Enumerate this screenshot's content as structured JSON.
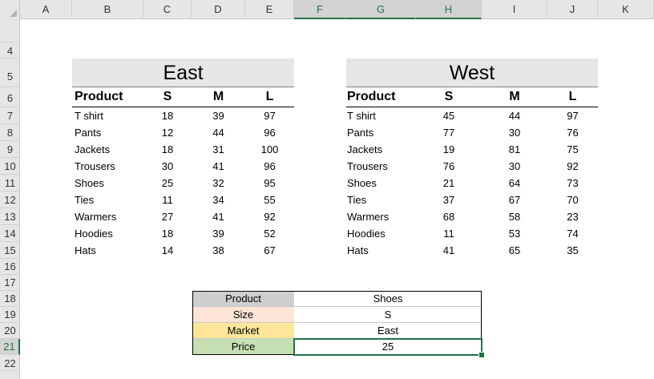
{
  "columns": [
    "A",
    "B",
    "C",
    "D",
    "E",
    "F",
    "G",
    "H",
    "I",
    "J",
    "K"
  ],
  "rows": [
    "4",
    "5",
    "6",
    "7",
    "8",
    "9",
    "10",
    "11",
    "12",
    "13",
    "14",
    "15",
    "16",
    "17",
    "18",
    "19",
    "20",
    "21",
    "22"
  ],
  "east": {
    "title": "East",
    "headers": [
      "Product",
      "S",
      "M",
      "L"
    ],
    "rows": [
      [
        "T shirt",
        "18",
        "39",
        "97"
      ],
      [
        "Pants",
        "12",
        "44",
        "96"
      ],
      [
        "Jackets",
        "18",
        "31",
        "100"
      ],
      [
        "Trousers",
        "30",
        "41",
        "96"
      ],
      [
        "Shoes",
        "25",
        "32",
        "95"
      ],
      [
        "Ties",
        "11",
        "34",
        "55"
      ],
      [
        "Warmers",
        "27",
        "41",
        "92"
      ],
      [
        "Hoodies",
        "18",
        "39",
        "52"
      ],
      [
        "Hats",
        "14",
        "38",
        "67"
      ]
    ]
  },
  "west": {
    "title": "West",
    "headers": [
      "Product",
      "S",
      "M",
      "L"
    ],
    "rows": [
      [
        "T shirt",
        "45",
        "44",
        "97"
      ],
      [
        "Pants",
        "77",
        "30",
        "76"
      ],
      [
        "Jackets",
        "19",
        "81",
        "75"
      ],
      [
        "Trousers",
        "76",
        "30",
        "92"
      ],
      [
        "Shoes",
        "21",
        "64",
        "73"
      ],
      [
        "Ties",
        "37",
        "67",
        "70"
      ],
      [
        "Warmers",
        "68",
        "58",
        "23"
      ],
      [
        "Hoodies",
        "11",
        "53",
        "74"
      ],
      [
        "Hats",
        "41",
        "65",
        "35"
      ]
    ]
  },
  "lookup": [
    {
      "label": "Product",
      "value": "Shoes",
      "color": "#d0cece"
    },
    {
      "label": "Size",
      "value": "S",
      "color": "#fce4d6"
    },
    {
      "label": "Market",
      "value": "East",
      "color": "#ffe699"
    },
    {
      "label": "Price",
      "value": "25",
      "color": "#c6e0b4"
    }
  ],
  "colors": {
    "accent": "#217346",
    "header_bg": "#e6e6e6",
    "title_band": "#e7e6e6"
  }
}
